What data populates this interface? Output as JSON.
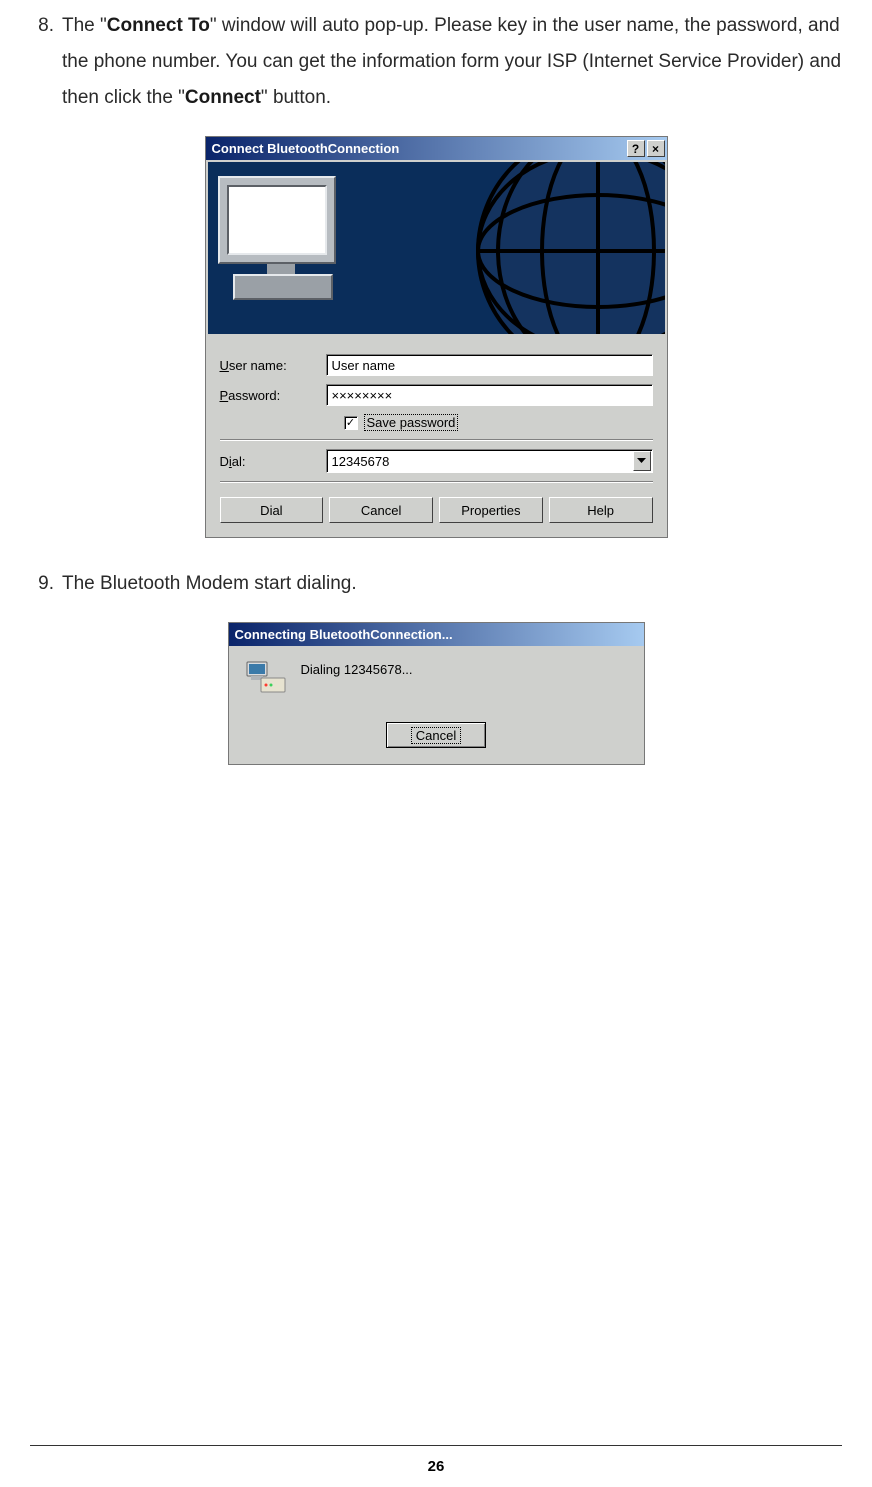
{
  "steps": {
    "s8": {
      "num": "8.",
      "t1": "The \"",
      "b1": "Connect To",
      "t2": "\" window will auto pop-up. Please key in the user name, the password, and the phone number. You can get the information form your ISP (Internet Service Provider) and then click the \"",
      "b2": "Connect",
      "t3": "\" button."
    },
    "s9": {
      "num": "9.",
      "text": "The Bluetooth Modem start dialing."
    }
  },
  "dialog1": {
    "title": "Connect BluetoothConnection",
    "help": "?",
    "close": "×",
    "username_label_pre": "U",
    "username_label_post": "ser name:",
    "username_value": "User name",
    "password_label_pre": "P",
    "password_label_post": "assword:",
    "password_value": "××××××××",
    "check_mark": "✓",
    "save_label_pre": "S",
    "save_label_post": "ave password",
    "dial_label_pre": "i",
    "dial_label_before": "D",
    "dial_label_after": "al:",
    "dial_value": "12345678",
    "btn_dial_pre": "D",
    "btn_dial_post": "ial",
    "btn_cancel": "Cancel",
    "btn_properties": "Properties",
    "btn_help_pre": "H",
    "btn_help_post": "elp"
  },
  "dialog2": {
    "title": "Connecting BluetoothConnection...",
    "status": "Dialing 12345678...",
    "cancel": "Cancel"
  },
  "page_number": "26"
}
